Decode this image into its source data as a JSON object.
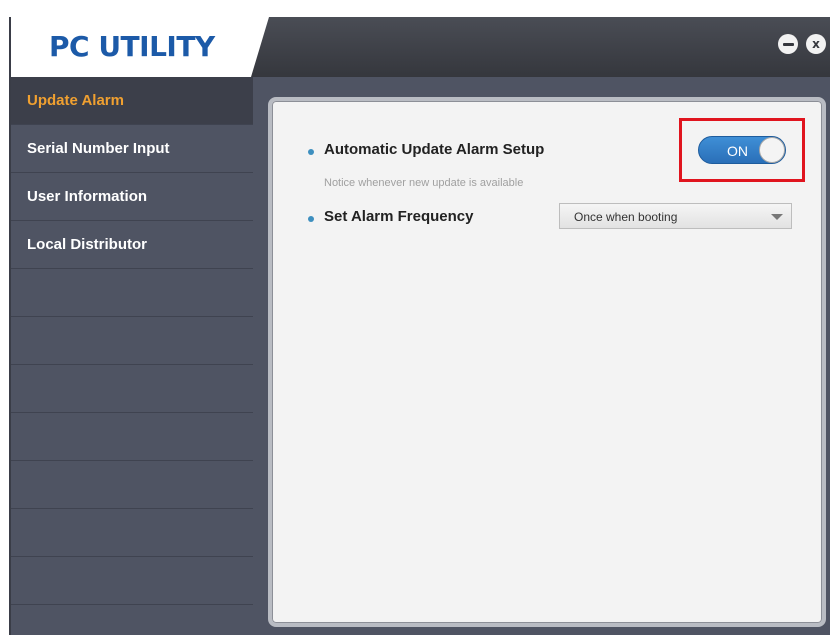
{
  "app": {
    "title": "PC UTILITY",
    "brand_color": "#1c5aa8",
    "accent_color": "#f0a030",
    "highlight_color": "#e0141e"
  },
  "window_controls": {
    "minimize_icon": "minimize-icon",
    "close_icon": "close-icon",
    "close_glyph": "x"
  },
  "sidebar": {
    "items": [
      {
        "label": "Update Alarm",
        "active": true
      },
      {
        "label": "Serial Number Input",
        "active": false
      },
      {
        "label": "User Information",
        "active": false
      },
      {
        "label": "Local Distributor",
        "active": false
      }
    ]
  },
  "settings": {
    "auto_update": {
      "label": "Automatic Update Alarm Setup",
      "notice": "Notice whenever new update is available",
      "toggle_state": "ON"
    },
    "frequency": {
      "label": "Set Alarm Frequency",
      "selected": "Once when booting"
    }
  }
}
